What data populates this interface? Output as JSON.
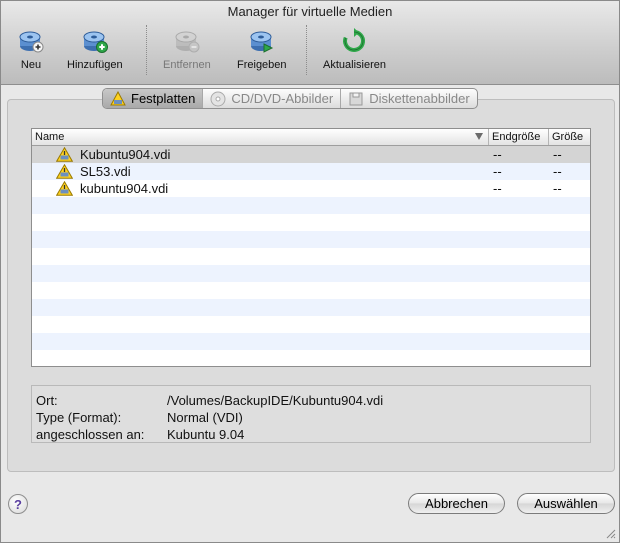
{
  "window": {
    "title": "Manager für virtuelle Medien"
  },
  "toolbar": {
    "items": [
      {
        "label": "Neu",
        "icon": "new-disk-icon",
        "enabled": true
      },
      {
        "label": "Hinzufügen",
        "icon": "add-disk-icon",
        "enabled": true
      },
      {
        "label": "Entfernen",
        "icon": "remove-disk-icon",
        "enabled": false
      },
      {
        "label": "Freigeben",
        "icon": "release-disk-icon",
        "enabled": true
      },
      {
        "label": "Aktualisieren",
        "icon": "refresh-icon",
        "enabled": true
      }
    ]
  },
  "tabs": [
    {
      "label": "Festplatten",
      "icon": "hard-disk-icon",
      "active": true
    },
    {
      "label": "CD/DVD-Abbilder",
      "icon": "cd-icon",
      "active": false
    },
    {
      "label": "Diskettenabbilder",
      "icon": "floppy-icon",
      "active": false
    }
  ],
  "list": {
    "columns": {
      "name": "Name",
      "virtual_size": "Endgröße",
      "size": "Größe"
    },
    "rows": [
      {
        "name": "Kubuntu904.vdi",
        "virtual_size": "--",
        "size": "--",
        "selected": true,
        "status_icon": "warning-icon"
      },
      {
        "name": "SL53.vdi",
        "virtual_size": "--",
        "size": "--",
        "selected": false,
        "status_icon": "warning-icon"
      },
      {
        "name": "kubuntu904.vdi",
        "virtual_size": "--",
        "size": "--",
        "selected": false,
        "status_icon": "warning-icon"
      }
    ]
  },
  "info": {
    "location_label": "Ort:",
    "location_value": "/Volumes/BackupIDE/Kubuntu904.vdi",
    "type_label": "Type (Format):",
    "type_value": "Normal (VDI)",
    "attached_label": "angeschlossen an:",
    "attached_value": "Kubuntu 9.04"
  },
  "help": {
    "symbol": "?"
  },
  "buttons": {
    "cancel": "Abbrechen",
    "select": "Auswählen"
  },
  "colors": {
    "selected_row": "#d4d4d4",
    "alt_row": "#edf3fe"
  }
}
